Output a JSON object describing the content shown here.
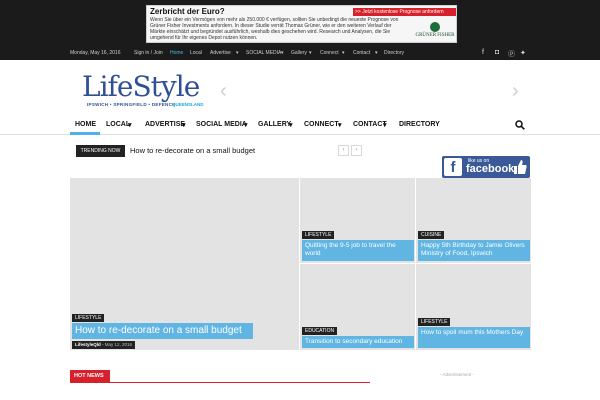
{
  "ad": {
    "title": "Zerbricht der Euro?",
    "cta": ">> Jetzt kostenlose Prognose anfordern",
    "body": "Wenn Sie über ein Vermögen von mehr als 250.000 € verfügen, sollten Sie unbedingt die neueste Prognose von Grüner Fisher Investments anfordern. In dieser Studie verrät Thomas Grüner, wie er den weiteren Verlauf der Märkte einschätzt und begründet ausführlich, weshalb dies geschehen wird. Research und Analysen, die Sie umgehend für Ihr eigenes Depot nutzen können.",
    "logo_text": "GRÜNER FISHER"
  },
  "topnav": {
    "date": "Monday, May 16, 2016",
    "signin": "Sign in / Join",
    "items": [
      "Home",
      "Local",
      "Advertise",
      "SOCIAL MEDIA",
      "Gallery",
      "Connect",
      "Contact",
      "Directory"
    ]
  },
  "logo": {
    "text": "LifeStyle",
    "subtitle": "IPSWICH • SPRINGFIELD • DEFENCE",
    "badge": "QUEENSLAND"
  },
  "mainnav": {
    "items": [
      "HOME",
      "LOCAL",
      "ADVERTISE",
      "SOCIAL MEDIA",
      "GALLERY",
      "CONNECT",
      "CONTACT",
      "DIRECTORY"
    ]
  },
  "trending": {
    "label": "TRENDING NOW",
    "headline": "How to re-decorate on a small budget"
  },
  "facebook": {
    "like": "like us on",
    "name": "facebook"
  },
  "grid": {
    "main": {
      "category": "LIFESTYLE",
      "title": "How to re-decorate on a small budget",
      "author": "LifestyleQld",
      "date": "May 12, 2016"
    },
    "t1": {
      "category": "LIFESTYLE",
      "title": "Quitting the 9-5 job to travel the world"
    },
    "t2": {
      "category": "CUISINE",
      "title": "Happy 5th Birthday to Jamie Olivers Ministry of Food, Ipswich"
    },
    "t3": {
      "category": "EDUCATION",
      "title": "Transition to secondary education"
    },
    "t4": {
      "category": "LIFESTYLE",
      "title": "How to spoil mum this Mothers Day"
    }
  },
  "hot_news": "HOT NEWS",
  "advertisement": "- Advertisement -",
  "colors": {
    "accent": "#4db2ec",
    "tile_title_bg": "#61b5e3",
    "hot_red": "#d6202b",
    "topbar": "#1b1b1b",
    "logo_blue": "#2f4f96"
  }
}
